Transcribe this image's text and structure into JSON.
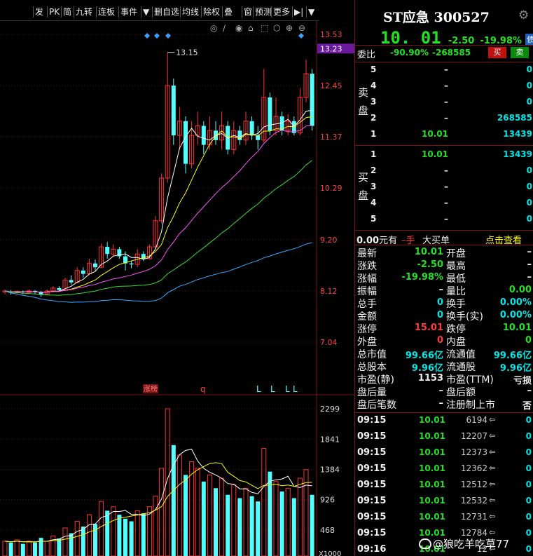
{
  "toolbar": {
    "items": [
      "发",
      "PK",
      "简",
      "九转",
      "连板",
      "事件",
      "▼",
      "删自选",
      "均线",
      "除权",
      "叠",
      "窗",
      "预测",
      "更多",
      "▶|",
      "▼"
    ]
  },
  "chart": {
    "price_labels": [
      "13.53",
      "13.23",
      "12.45",
      "11.37",
      "10.29",
      "9.20",
      "8.12",
      "7.04"
    ],
    "high_label": "13.15",
    "marker_zt": "涨榜",
    "marker_q": "q",
    "marker_l": [
      "L",
      "L",
      "L",
      "L"
    ],
    "vol_labels": [
      "2299",
      "1841",
      "1384",
      "926",
      "468"
    ],
    "vol_unit": "X1000"
  },
  "chart_data": {
    "type": "candlestick",
    "price_axis_ticks": [
      13.53,
      12.45,
      11.37,
      10.29,
      9.2,
      8.12,
      7.04
    ],
    "current_price_marker": 13.23,
    "volume_axis_ticks": [
      2299,
      1841,
      1384,
      926,
      468
    ],
    "volume_unit": "X1000",
    "annotated_high": 13.15
  },
  "header": {
    "name": "ST应急",
    "code": "300527",
    "price": "10. 01",
    "change": "-2.50",
    "pct": "-19.98%",
    "badge": "债"
  },
  "weibi": {
    "label": "委比",
    "pct": "-90.90%",
    "diff": "-268585",
    "buy": "买",
    "sell": "卖"
  },
  "sell_side": {
    "label1": "卖",
    "label2": "盘",
    "rows": [
      {
        "lvl": "5",
        "price": "–",
        "vol": "0"
      },
      {
        "lvl": "4",
        "price": "–",
        "vol": "0"
      },
      {
        "lvl": "3",
        "price": "–",
        "vol": "0"
      },
      {
        "lvl": "2",
        "price": "–",
        "vol": "268585"
      },
      {
        "lvl": "1",
        "price": "10.01",
        "vol": "13439"
      }
    ]
  },
  "buy_side": {
    "label1": "买",
    "label2": "盘",
    "rows": [
      {
        "lvl": "1",
        "price": "10.01",
        "vol": "13439"
      },
      {
        "lvl": "2",
        "price": "–",
        "vol": "0"
      },
      {
        "lvl": "3",
        "price": "–",
        "vol": "0"
      },
      {
        "lvl": "4",
        "price": "–",
        "vol": "0"
      },
      {
        "lvl": "5",
        "price": "–",
        "vol": "0"
      }
    ]
  },
  "bigorder": {
    "a": "0.00",
    "a_unit": "元有",
    "b": "–手",
    "c": "大买单",
    "link": "点击查看"
  },
  "quote_left": [
    {
      "k": "最新",
      "v": "10.01",
      "c": "green"
    },
    {
      "k": "涨跌",
      "v": "-2.50",
      "c": "green"
    },
    {
      "k": "涨幅",
      "v": "-19.98%",
      "c": "green"
    },
    {
      "k": "振幅",
      "v": "–",
      "c": "white"
    },
    {
      "k": "总手",
      "v": "0",
      "c": "cyan"
    },
    {
      "k": "金额",
      "v": "0",
      "c": "cyan"
    },
    {
      "k": "涨停",
      "v": "15.01",
      "c": "red"
    },
    {
      "k": "外盘",
      "v": "0",
      "c": "red"
    },
    {
      "k": "总市值",
      "v": "99.66亿",
      "c": "cyan"
    },
    {
      "k": "总股本",
      "v": "9.96亿",
      "c": "cyan"
    },
    {
      "k": "市盈(静)",
      "v": "1153",
      "c": "white"
    },
    {
      "k": "盘后量",
      "v": "–",
      "c": "white"
    },
    {
      "k": "盘后笔数",
      "v": "–",
      "c": "white"
    }
  ],
  "quote_right": [
    {
      "k": "开盘",
      "v": "–",
      "c": "white"
    },
    {
      "k": "最高",
      "v": "–",
      "c": "white"
    },
    {
      "k": "最低",
      "v": "–",
      "c": "white"
    },
    {
      "k": "量比",
      "v": "0.00",
      "c": "green"
    },
    {
      "k": "换手",
      "v": "0.00%",
      "c": "cyan"
    },
    {
      "k": "换手(实)",
      "v": "0.00%",
      "c": "cyan"
    },
    {
      "k": "跌停",
      "v": "10.01",
      "c": "green"
    },
    {
      "k": "内盘",
      "v": "0",
      "c": "green"
    },
    {
      "k": "流通值",
      "v": "99.66亿",
      "c": "cyan"
    },
    {
      "k": "流通股",
      "v": "9.96亿",
      "c": "cyan"
    },
    {
      "k": "市盈(TTM)",
      "v": "亏损",
      "c": "white"
    },
    {
      "k": "盘后额",
      "v": "–",
      "c": "white"
    },
    {
      "k": "注册制上市",
      "v": "否",
      "c": "white"
    }
  ],
  "ticks": [
    {
      "t": "09:15",
      "p": "10.01",
      "v": "6194"
    },
    {
      "t": "09:15",
      "p": "10.01",
      "v": "12207"
    },
    {
      "t": "09:15",
      "p": "10.01",
      "v": "12373"
    },
    {
      "t": "09:15",
      "p": "10.01",
      "v": "12362"
    },
    {
      "t": "09:15",
      "p": "10.01",
      "v": "12512"
    },
    {
      "t": "09:15",
      "p": "10.01",
      "v": "12532"
    },
    {
      "t": "09:15",
      "p": "10.01",
      "v": "12731"
    },
    {
      "t": "09:15",
      "p": "10.01",
      "v": "12784"
    },
    {
      "t": "09:16",
      "p": "10.01",
      "v": "12",
      "extra": "0"
    }
  ],
  "watermark": "@狼吃羊吃草77"
}
